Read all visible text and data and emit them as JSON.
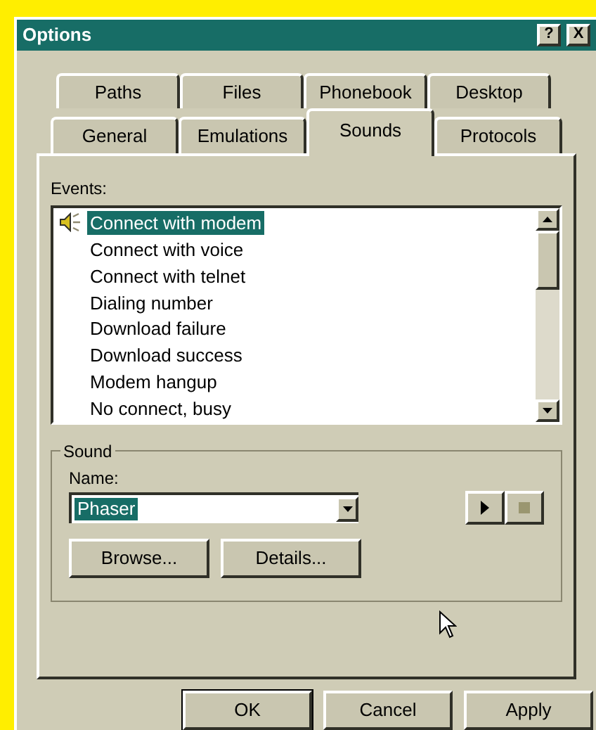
{
  "window": {
    "title": "Options",
    "help_button": "?",
    "close_button": "X"
  },
  "tabs_back": [
    {
      "label": "Paths",
      "selected": false
    },
    {
      "label": "Files",
      "selected": false
    },
    {
      "label": "Phonebook",
      "selected": false
    },
    {
      "label": "Desktop",
      "selected": false
    }
  ],
  "tabs_front": [
    {
      "label": "General",
      "selected": false
    },
    {
      "label": "Emulations",
      "selected": false
    },
    {
      "label": "Sounds",
      "selected": true
    },
    {
      "label": "Protocols",
      "selected": false
    }
  ],
  "events": {
    "label": "Events:",
    "items": [
      {
        "label": "Connect with modem",
        "selected": true,
        "has_sound": true
      },
      {
        "label": "Connect with voice",
        "selected": false,
        "has_sound": false
      },
      {
        "label": "Connect with telnet",
        "selected": false,
        "has_sound": false
      },
      {
        "label": "Dialing number",
        "selected": false,
        "has_sound": false
      },
      {
        "label": "Download failure",
        "selected": false,
        "has_sound": false
      },
      {
        "label": "Download success",
        "selected": false,
        "has_sound": false
      },
      {
        "label": "Modem hangup",
        "selected": false,
        "has_sound": false
      },
      {
        "label": "No connect, busy",
        "selected": false,
        "has_sound": false
      }
    ]
  },
  "sound": {
    "title": "Sound",
    "name_label": "Name:",
    "name_value": "Phaser",
    "buttons": [
      "Browse...",
      "Details..."
    ]
  },
  "buttons": [
    {
      "label": "OK",
      "default": true
    },
    {
      "label": "Cancel",
      "default": false
    },
    {
      "label": "Apply",
      "default": false
    }
  ]
}
